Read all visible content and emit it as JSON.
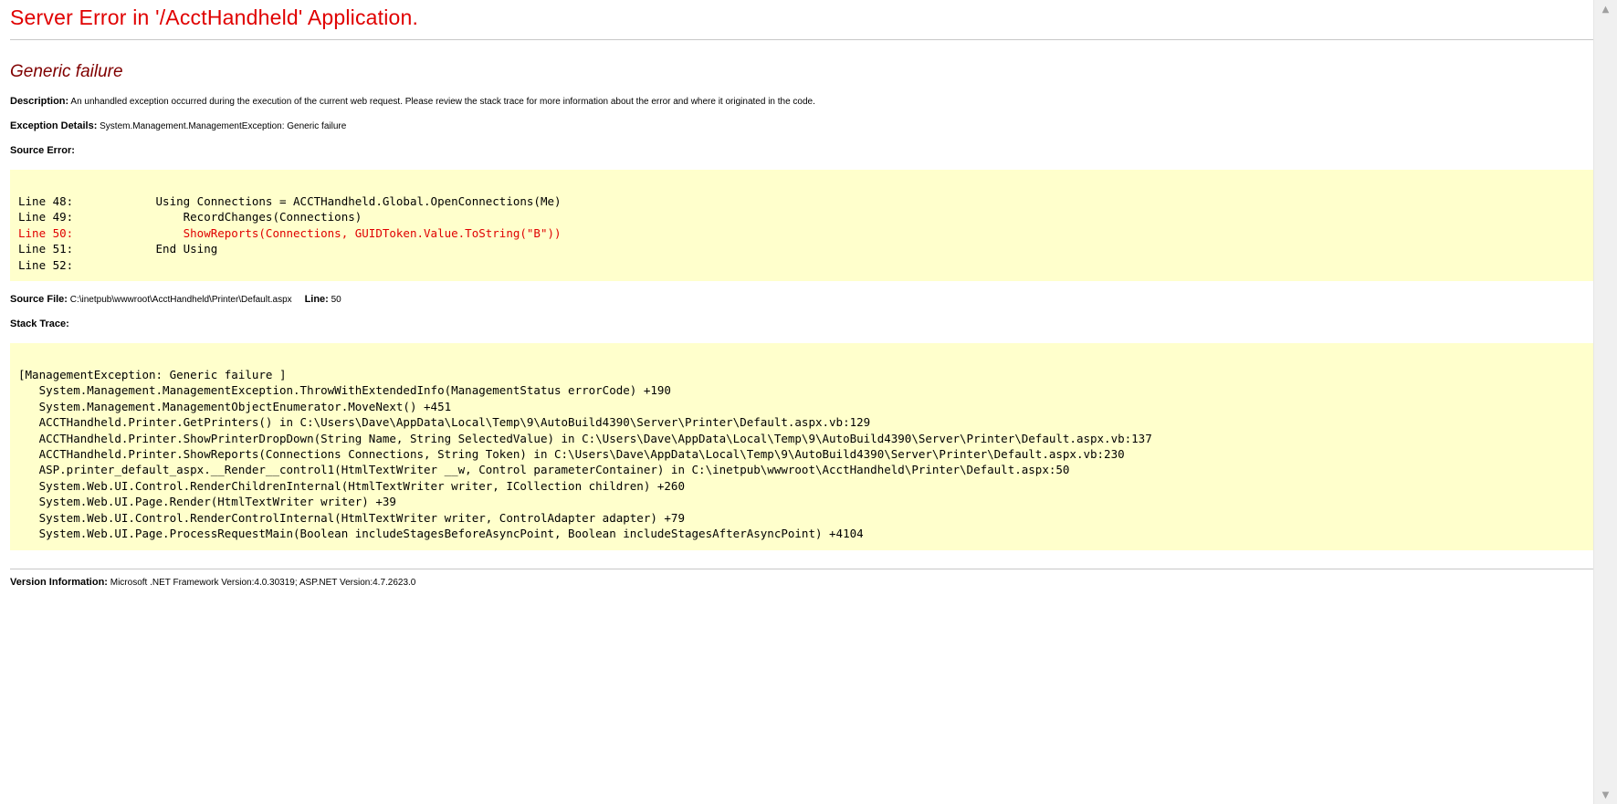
{
  "page": {
    "title": "Server Error in '/AcctHandheld' Application.",
    "error_heading": "Generic failure",
    "description": {
      "label": "Description:",
      "text": "An unhandled exception occurred during the execution of the current web request. Please review the stack trace for more information about the error and where it originated in the code."
    },
    "exception": {
      "label": "Exception Details:",
      "text": "System.Management.ManagementException: Generic failure"
    },
    "source_error_label": "Source Error:",
    "source_lines": [
      {
        "text": "Line 48:            Using Connections = ACCTHandheld.Global.OpenConnections(Me)",
        "highlight": false
      },
      {
        "text": "Line 49:                RecordChanges(Connections)",
        "highlight": false
      },
      {
        "text": "Line 50:                ShowReports(Connections, GUIDToken.Value.ToString(\"B\"))",
        "highlight": true
      },
      {
        "text": "Line 51:            End Using",
        "highlight": false
      },
      {
        "text": "Line 52:",
        "highlight": false
      }
    ],
    "source_file": {
      "label": "Source File:",
      "path": "C:\\inetpub\\wwwroot\\AcctHandheld\\Printer\\Default.aspx",
      "line_label": "Line:",
      "line_value": "50"
    },
    "stack_trace_label": "Stack Trace:",
    "stack_lines": [
      "[ManagementException: Generic failure ]",
      "   System.Management.ManagementException.ThrowWithExtendedInfo(ManagementStatus errorCode) +190",
      "   System.Management.ManagementObjectEnumerator.MoveNext() +451",
      "   ACCTHandheld.Printer.GetPrinters() in C:\\Users\\Dave\\AppData\\Local\\Temp\\9\\AutoBuild4390\\Server\\Printer\\Default.aspx.vb:129",
      "   ACCTHandheld.Printer.ShowPrinterDropDown(String Name, String SelectedValue) in C:\\Users\\Dave\\AppData\\Local\\Temp\\9\\AutoBuild4390\\Server\\Printer\\Default.aspx.vb:137",
      "   ACCTHandheld.Printer.ShowReports(Connections Connections, String Token) in C:\\Users\\Dave\\AppData\\Local\\Temp\\9\\AutoBuild4390\\Server\\Printer\\Default.aspx.vb:230",
      "   ASP.printer_default_aspx.__Render__control1(HtmlTextWriter __w, Control parameterContainer) in C:\\inetpub\\wwwroot\\AcctHandheld\\Printer\\Default.aspx:50",
      "   System.Web.UI.Control.RenderChildrenInternal(HtmlTextWriter writer, ICollection children) +260",
      "   System.Web.UI.Page.Render(HtmlTextWriter writer) +39",
      "   System.Web.UI.Control.RenderControlInternal(HtmlTextWriter writer, ControlAdapter adapter) +79",
      "   System.Web.UI.Page.ProcessRequestMain(Boolean includeStagesBeforeAsyncPoint, Boolean includeStagesAfterAsyncPoint) +4104"
    ],
    "version": {
      "label": "Version Information:",
      "text": "Microsoft .NET Framework Version:4.0.30319; ASP.NET Version:4.7.2623.0"
    }
  },
  "scrollbar": {
    "up_icon": "scroll-up-arrow-icon",
    "down_icon": "scroll-down-arrow-icon"
  },
  "colors": {
    "title": "#e00000",
    "heading": "#800000",
    "code_bg": "#ffffcc",
    "highlight_line": "#e00000"
  }
}
